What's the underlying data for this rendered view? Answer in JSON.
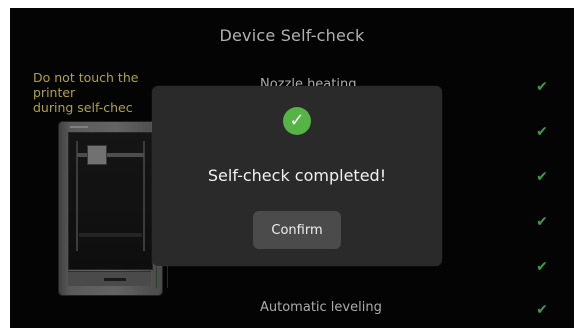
{
  "screen": {
    "title": "Device Self-check",
    "warning": "Do not touch the printer\nduring self-chec"
  },
  "checks": [
    {
      "label": "Nozzle heating",
      "status_icon": "check-icon"
    },
    {
      "label": "",
      "status_icon": "check-icon"
    },
    {
      "label": "",
      "status_icon": "check-icon"
    },
    {
      "label": "",
      "status_icon": "check-icon"
    },
    {
      "label": "",
      "status_icon": "check-icon"
    },
    {
      "label": "Automatic leveling",
      "status_icon": "check-icon"
    }
  ],
  "dialog": {
    "icon": "check-circle-icon",
    "message": "Self-check completed!",
    "confirm_label": "Confirm"
  },
  "colors": {
    "background": "#050505",
    "dialog": "#2a2a2a",
    "accent_green": "#56b346",
    "warning_yellow": "#d7c54a"
  }
}
